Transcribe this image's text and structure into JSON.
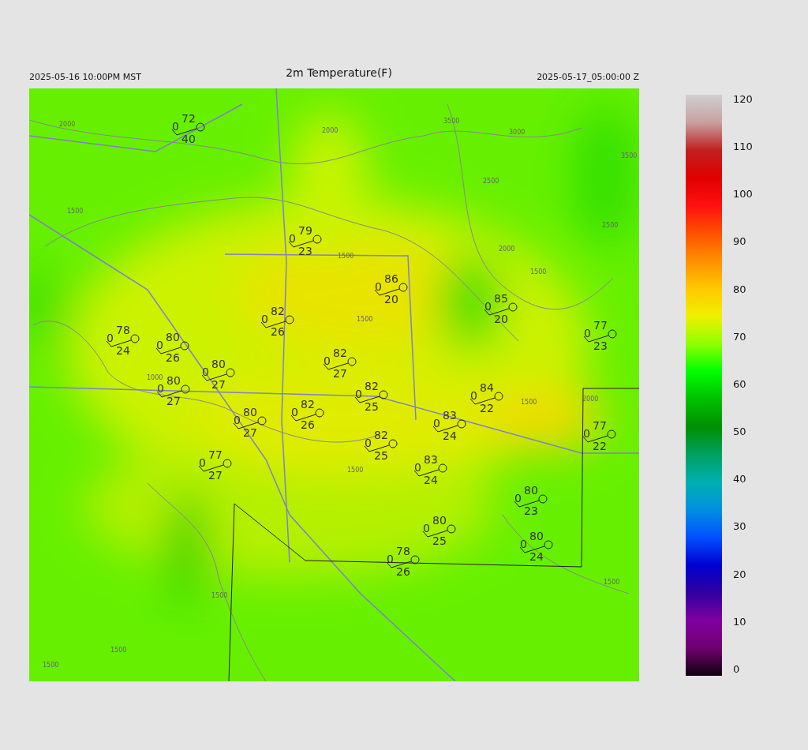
{
  "header": {
    "valid_time_local": "2025-05-16 10:00PM MST",
    "title": "2m Temperature(F)",
    "valid_time_utc": "2025-05-17_05:00:00 Z"
  },
  "stations": [
    {
      "temperature": "72",
      "value": "0",
      "dewpoint": "40"
    },
    {
      "temperature": "79",
      "value": "0",
      "dewpoint": "23"
    },
    {
      "temperature": "86",
      "value": "0",
      "dewpoint": "20"
    },
    {
      "temperature": "85",
      "value": "0",
      "dewpoint": "20"
    },
    {
      "temperature": "82",
      "value": "0",
      "dewpoint": "26"
    },
    {
      "temperature": "78",
      "value": "0",
      "dewpoint": "24"
    },
    {
      "temperature": "80",
      "value": "0",
      "dewpoint": "26"
    },
    {
      "temperature": "77",
      "value": "0",
      "dewpoint": "23"
    },
    {
      "temperature": "82",
      "value": "0",
      "dewpoint": "27"
    },
    {
      "temperature": "80",
      "value": "0",
      "dewpoint": "27"
    },
    {
      "temperature": "80",
      "value": "0",
      "dewpoint": "27"
    },
    {
      "temperature": "82",
      "value": "0",
      "dewpoint": "25"
    },
    {
      "temperature": "84",
      "value": "0",
      "dewpoint": "22"
    },
    {
      "temperature": "82",
      "value": "0",
      "dewpoint": "26"
    },
    {
      "temperature": "80",
      "value": "0",
      "dewpoint": "27"
    },
    {
      "temperature": "83",
      "value": "0",
      "dewpoint": "24"
    },
    {
      "temperature": "82",
      "value": "0",
      "dewpoint": "25"
    },
    {
      "temperature": "77",
      "value": "0",
      "dewpoint": "22"
    },
    {
      "temperature": "77",
      "value": "0",
      "dewpoint": "27"
    },
    {
      "temperature": "83",
      "value": "0",
      "dewpoint": "24"
    },
    {
      "temperature": "80",
      "value": "0",
      "dewpoint": "23"
    },
    {
      "temperature": "80",
      "value": "0",
      "dewpoint": "25"
    },
    {
      "temperature": "80",
      "value": "0",
      "dewpoint": "24"
    },
    {
      "temperature": "78",
      "value": "0",
      "dewpoint": "26"
    }
  ],
  "contour_labels": [
    "2000",
    "3500",
    "3000",
    "2000",
    "2500",
    "3500",
    "1500",
    "2500",
    "2000",
    "1500",
    "1500",
    "1500",
    "1000",
    "2000",
    "1500",
    "1500",
    "1500",
    "1500",
    "1500",
    "1500"
  ],
  "colorbar": {
    "ticks": [
      "120",
      "110",
      "100",
      "90",
      "80",
      "70",
      "60",
      "50",
      "40",
      "30",
      "20",
      "10",
      "0"
    ]
  }
}
